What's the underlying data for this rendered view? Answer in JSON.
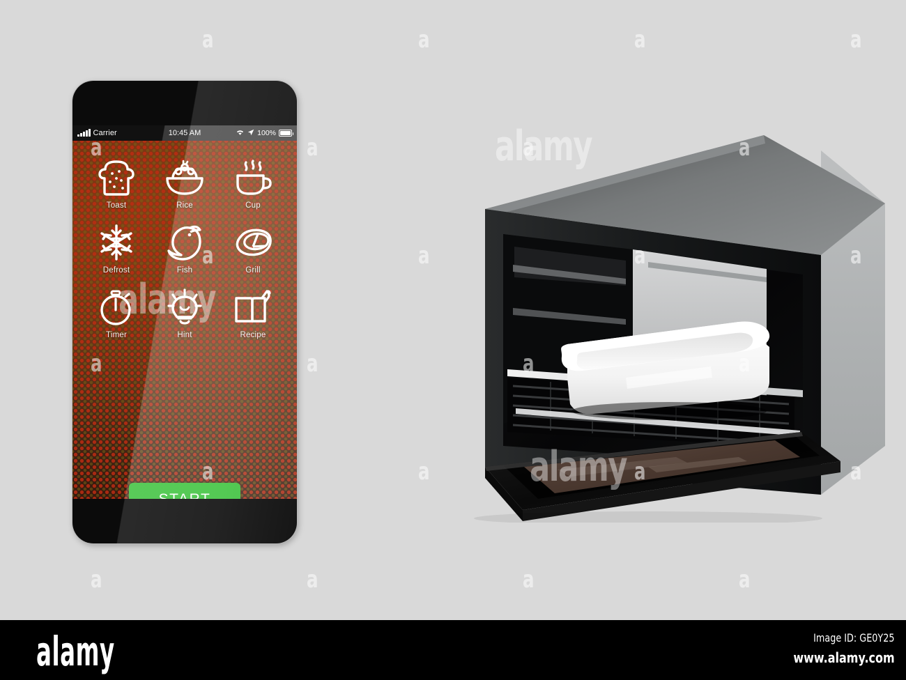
{
  "background_color": "#d9d9d9",
  "watermark": {
    "letter": "a",
    "brand": "alamy"
  },
  "phone": {
    "status_bar": {
      "carrier": "Carrier",
      "time": "10:45 AM",
      "battery_percent": "100%",
      "signal_icon": "signal-bars-icon",
      "wifi_icon": "wifi-icon",
      "location_icon": "location-arrow-icon",
      "battery_icon": "battery-full-icon"
    },
    "app": {
      "menu": [
        {
          "label": "Toast",
          "icon": "toast-bread-icon"
        },
        {
          "label": "Rice",
          "icon": "rice-bowl-icon"
        },
        {
          "label": "Cup",
          "icon": "hot-cup-icon"
        },
        {
          "label": "Defrost",
          "icon": "snowflake-icon"
        },
        {
          "label": "Fish",
          "icon": "fish-icon"
        },
        {
          "label": "Grill",
          "icon": "steak-meat-icon"
        },
        {
          "label": "Timer",
          "icon": "stopwatch-icon"
        },
        {
          "label": "Hint",
          "icon": "lightbulb-icon"
        },
        {
          "label": "Recipe",
          "icon": "open-book-icon"
        }
      ],
      "start_button": {
        "label": "START",
        "color": "#2fbe2f"
      }
    }
  },
  "product": {
    "name": "microwave-oven",
    "door_state": "open",
    "parts": {
      "body": "oven-body",
      "door": "oven-door",
      "tray": "white-tray",
      "rack": "wire-rack"
    }
  },
  "footer": {
    "logo": "alamy",
    "image_id": "Image ID: GE0Y25",
    "website": "www.alamy.com"
  }
}
